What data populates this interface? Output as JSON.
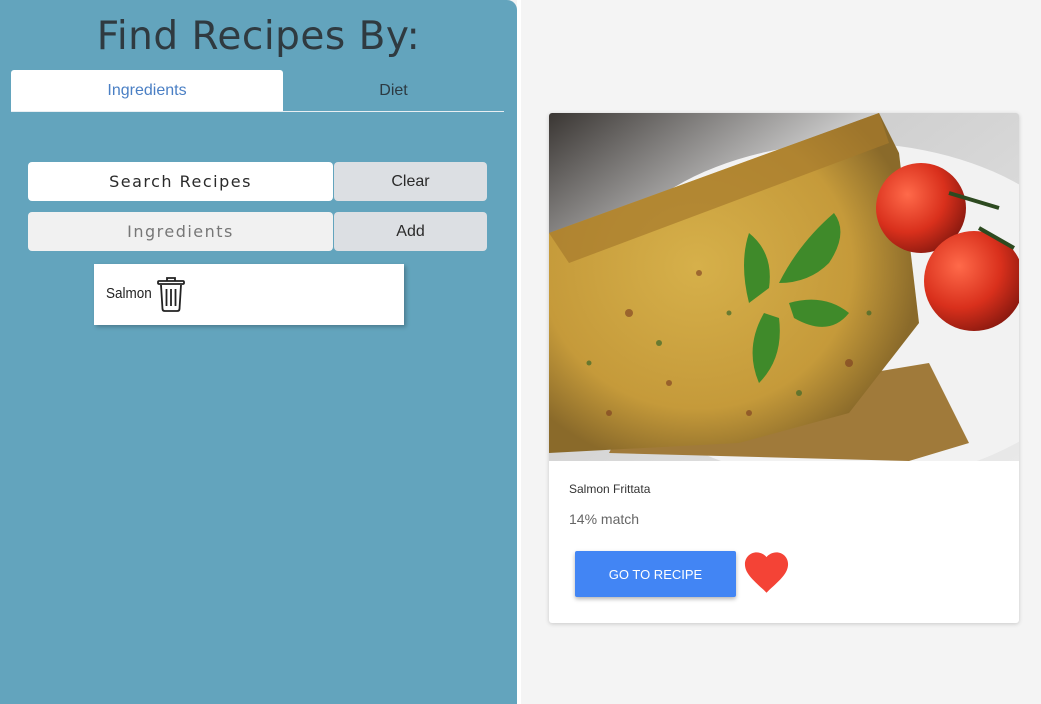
{
  "sidebar": {
    "title": "Find Recipes By:",
    "tabs": [
      {
        "label": "Ingredients",
        "active": true
      },
      {
        "label": "Diet",
        "active": false
      }
    ],
    "search": {
      "placeholder": "Search Recipes",
      "value": ""
    },
    "clear_label": "Clear",
    "ingredient_input": {
      "placeholder": "Ingredients",
      "value": ""
    },
    "add_label": "Add",
    "ingredients": [
      {
        "label": "Salmon",
        "icon": "trash-icon"
      }
    ]
  },
  "results": {
    "recipes": [
      {
        "name": "Salmon Frittata",
        "match": "14% match",
        "button_label": "GO TO RECIPE",
        "favorite_icon": "heart-icon"
      }
    ]
  },
  "colors": {
    "sidebar_bg": "#63a4bd",
    "primary_button": "#4285f4",
    "heart": "#f44336",
    "active_tab_text": "#4a7fc4"
  }
}
